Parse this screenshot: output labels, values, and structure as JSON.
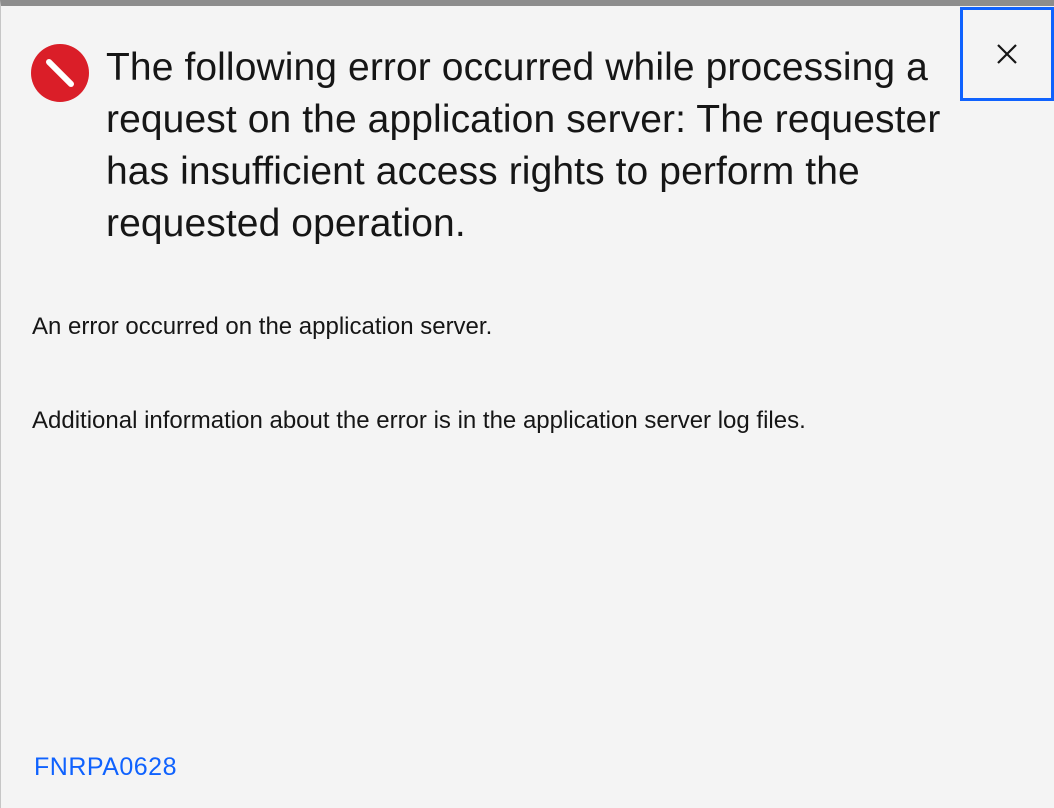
{
  "dialog": {
    "title": "The following error occurred while processing a request on the application server: The requester has insufficient access rights to perform the requested operation.",
    "messages": [
      "An error occurred on the application server.",
      "Additional information about the error is in the application server log files."
    ],
    "error_code": "FNRPA0628",
    "icons": {
      "status": "error-circle-icon",
      "close": "close-icon"
    },
    "colors": {
      "error_red": "#da1e28",
      "link_blue": "#0f62fe",
      "focus_blue": "#0f62fe",
      "background": "#f4f4f4",
      "text": "#161616"
    }
  }
}
